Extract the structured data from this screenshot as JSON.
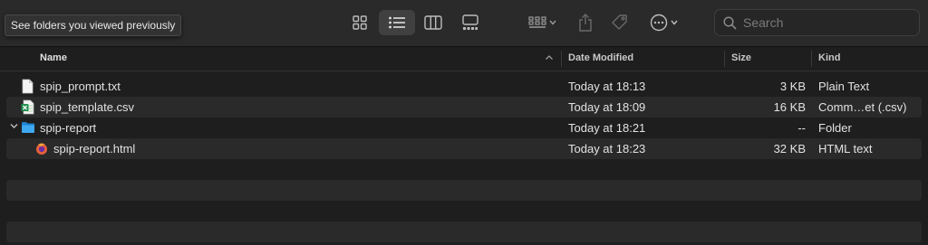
{
  "toolbar": {
    "tooltip": "See folders you viewed previously",
    "view_buttons": [
      {
        "name": "icon-view-button",
        "icon": "grid-icon"
      },
      {
        "name": "list-view-button",
        "icon": "list-icon",
        "active": true
      },
      {
        "name": "column-view-button",
        "icon": "columns-icon"
      },
      {
        "name": "gallery-view-button",
        "icon": "gallery-icon"
      }
    ],
    "group_button_icon": "group-grid-icon",
    "share_button_icon": "share-icon",
    "tag_button_icon": "tag-icon",
    "more_button_icon": "ellipsis-circle-icon",
    "search": {
      "placeholder": "Search",
      "value": ""
    }
  },
  "columns": {
    "name": "Name",
    "date": "Date Modified",
    "size": "Size",
    "kind": "Kind",
    "sorted_by": "Name",
    "sort_direction": "ascending"
  },
  "files": [
    {
      "name": "spip_prompt.txt",
      "date": "Today at 18:13",
      "size": "3 KB",
      "kind": "Plain Text",
      "icon": "text-file-icon",
      "indent": 0
    },
    {
      "name": "spip_template.csv",
      "date": "Today at 18:09",
      "size": "16 KB",
      "kind": "Comm…et (.csv)",
      "icon": "spreadsheet-file-icon",
      "indent": 0
    },
    {
      "name": "spip-report",
      "date": "Today at 18:21",
      "size": "--",
      "kind": "Folder",
      "icon": "folder-icon",
      "indent": 0,
      "expanded": true
    },
    {
      "name": "spip-report.html",
      "date": "Today at 18:23",
      "size": "32 KB",
      "kind": "HTML text",
      "icon": "html-file-icon",
      "indent": 1
    }
  ],
  "colors": {
    "background": "#1e1e1e",
    "toolbar": "#2a2a2a",
    "alt_row": "#2a2a2a",
    "folder_blue": "#3fa8f0",
    "csv_green": "#1f8f4e",
    "html_orange": "#e8613a"
  }
}
